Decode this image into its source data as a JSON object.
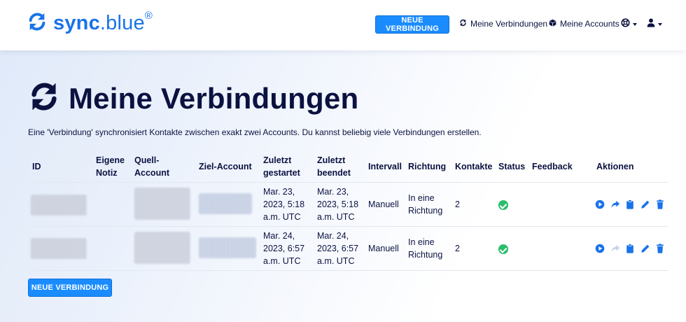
{
  "brand": {
    "name_bold": "sync",
    "name_light": ".blue",
    "reg": "®"
  },
  "nav": {
    "new_connection": "NEUE VERBINDUNG",
    "my_connections": "Meine Verbindungen",
    "my_accounts": "Meine Accounts"
  },
  "page": {
    "title": "Meine Verbindungen",
    "description": "Eine 'Verbindung' synchronisiert Kontakte zwischen exakt zwei Accounts. Du kannst beliebig viele Verbindungen erstellen."
  },
  "table": {
    "headers": {
      "id": "ID",
      "note_1": "Eigene",
      "note_2": "Notiz",
      "source_1": "Quell-",
      "source_2": "Account",
      "target": "Ziel-Account",
      "started_1": "Zuletzt",
      "started_2": "gestartet",
      "ended_1": "Zuletzt",
      "ended_2": "beendet",
      "interval": "Intervall",
      "direction": "Richtung",
      "contacts": "Kontakte",
      "status": "Status",
      "feedback": "Feedback",
      "actions": "Aktionen"
    },
    "rows": [
      {
        "started": [
          "Mar. 23,",
          "2023, 5:18",
          "a.m. UTC"
        ],
        "ended": [
          "Mar. 23,",
          "2023, 5:18",
          "a.m. UTC"
        ],
        "interval": "Manuell",
        "direction": [
          "In eine",
          "Richtung"
        ],
        "contacts": "2",
        "status": "ok"
      },
      {
        "started": [
          "Mar. 24,",
          "2023, 6:57",
          "a.m. UTC"
        ],
        "ended": [
          "Mar. 24,",
          "2023, 6:57",
          "a.m. UTC"
        ],
        "interval": "Manuell",
        "direction": [
          "In eine",
          "Richtung"
        ],
        "contacts": "2",
        "status": "ok"
      }
    ]
  },
  "footer_button": "NEUE VERBINDUNG",
  "colors": {
    "accent": "#1a73e8",
    "button": "#1a8cff",
    "text": "#0b1240",
    "success": "#2cbe6b"
  },
  "icons": [
    "sync-icon",
    "cube-icon",
    "lifebuoy-icon",
    "user-icon",
    "play-icon",
    "share-icon",
    "clipboard-icon",
    "pencil-icon",
    "trash-icon"
  ]
}
